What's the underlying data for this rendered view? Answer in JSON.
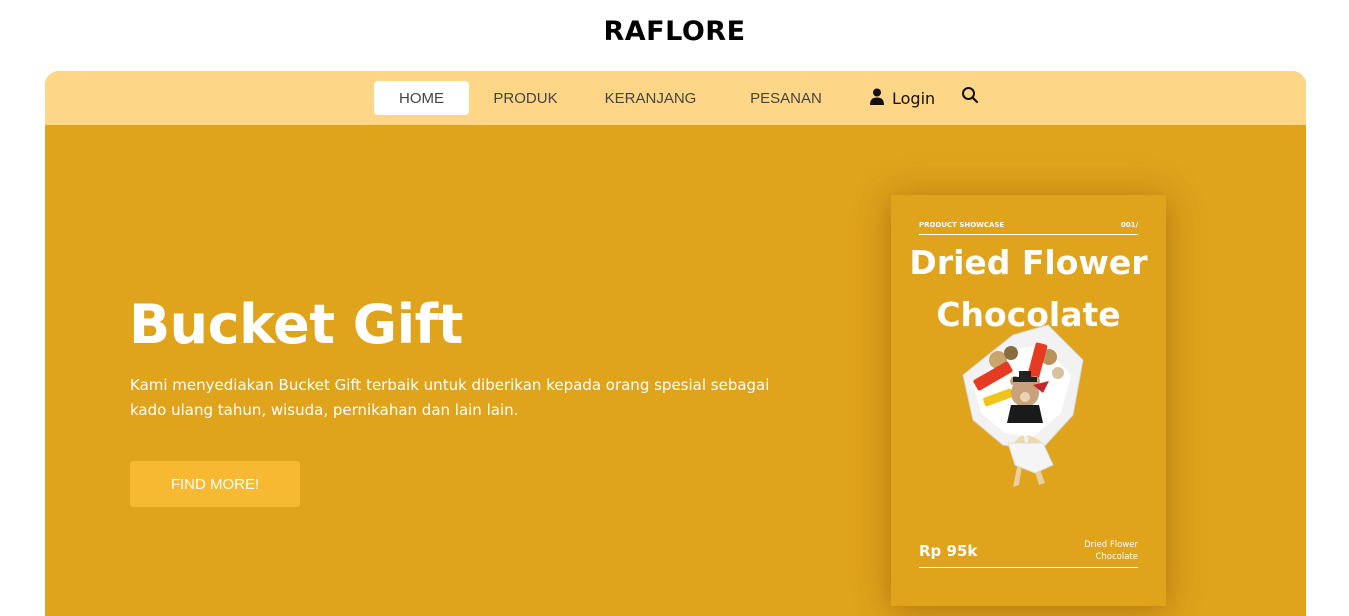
{
  "header": {
    "brand": "RAFLORE"
  },
  "nav": {
    "items": [
      {
        "label": "HOME",
        "active": true
      },
      {
        "label": "PRODUK",
        "active": false
      },
      {
        "label": "KERANJANG",
        "active": false
      },
      {
        "label": "PESANAN",
        "active": false
      }
    ],
    "login_label": "Login",
    "login_icon": "user-icon",
    "search_icon": "search-icon"
  },
  "hero": {
    "title": "Bucket Gift",
    "description": "Kami menyediakan Bucket Gift terbaik untuk diberikan kepada orang spesial sebagai kado ulang tahun, wisuda, pernikahan dan lain lain.",
    "cta_label": "FIND MORE!"
  },
  "showcase": {
    "label": "PRODUCT SHOWCASE",
    "index": "001/",
    "title": "Dried Flower Chocolate",
    "price": "Rp 95k",
    "name": "Dried Flower Chocolate"
  },
  "colors": {
    "hero_bg": "#e0a31c",
    "nav_bg": "#fed687",
    "cta_bg": "#f7b932"
  }
}
